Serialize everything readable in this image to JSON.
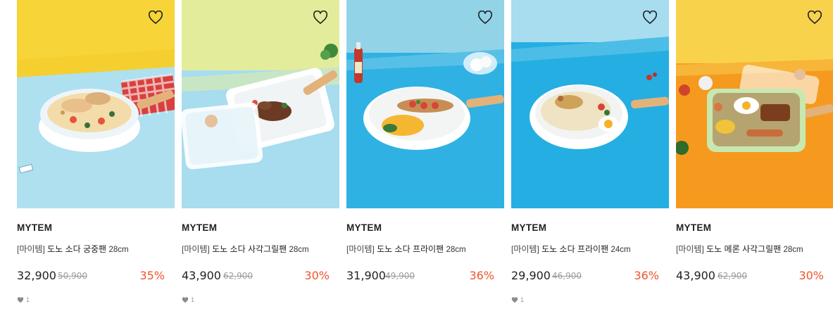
{
  "products": [
    {
      "brand": "MYTEM",
      "bracket": "[마이템]",
      "name": "도노 소다 궁중팬",
      "size": "28cm",
      "price": "32,900",
      "original_price": "50,900",
      "discount": "35%",
      "likes": "1",
      "show_likes": true
    },
    {
      "brand": "MYTEM",
      "bracket": "[마이템]",
      "name": "도노 소다 사각그릴팬",
      "size": "28cm",
      "price": "43,900",
      "original_price": "62,900",
      "discount": "30%",
      "likes": "1",
      "show_likes": true
    },
    {
      "brand": "MYTEM",
      "bracket": "[마이템]",
      "name": "도노 소다 프라이팬",
      "size": "28cm",
      "price": "31,900",
      "original_price": "49,900",
      "discount": "36%",
      "likes": "",
      "show_likes": false
    },
    {
      "brand": "MYTEM",
      "bracket": "[마이템]",
      "name": "도노 소다 프라이팬",
      "size": "24cm",
      "price": "29,900",
      "original_price": "46,900",
      "discount": "36%",
      "likes": "1",
      "show_likes": true
    },
    {
      "brand": "MYTEM",
      "bracket": "[마이템]",
      "name": "도노 메론 사각그릴팬",
      "size": "28cm",
      "price": "43,900",
      "original_price": "62,900",
      "discount": "30%",
      "likes": "",
      "show_likes": false
    }
  ],
  "icons": {
    "wishlist": "heart-outline-icon",
    "likes": "heart-filled-icon"
  },
  "colors": {
    "discount": "#f0542d",
    "sky_blue": "#8fd3ec",
    "yellow": "#f5d33c",
    "orange": "#f59a1e"
  }
}
